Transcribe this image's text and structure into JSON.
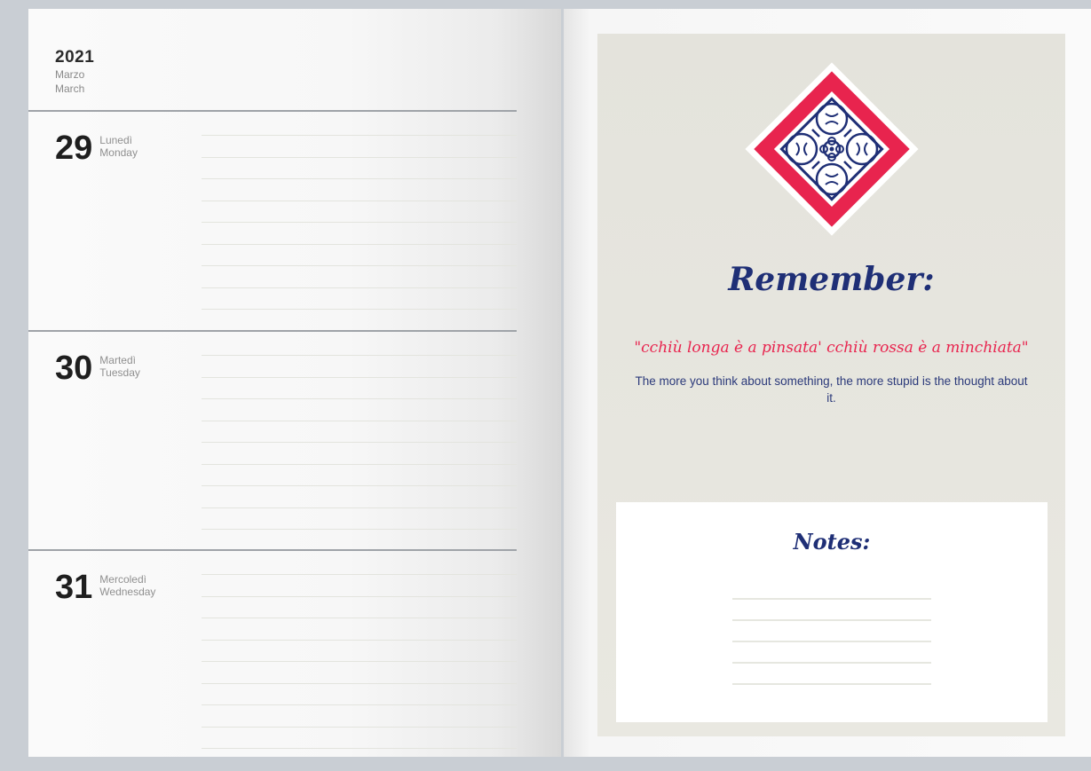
{
  "planner": {
    "year": "2021",
    "month_it": "Marzo",
    "month_en": "March",
    "days": [
      {
        "num": "29",
        "name_it": "Lunedì",
        "name_en": "Monday"
      },
      {
        "num": "30",
        "name_it": "Martedì",
        "name_en": "Tuesday"
      },
      {
        "num": "31",
        "name_it": "Mercoledì",
        "name_en": "Wednesday"
      }
    ]
  },
  "right_page": {
    "heading": "Remember:",
    "quote": "\"cchiù longa è a pinsata' cchiù rossa è a minchiata\"",
    "translation": "The more you think about something, the more stupid is the thought about it.",
    "notes_title": "Notes:"
  },
  "colors": {
    "navy": "#1f2f76",
    "red": "#e8244e",
    "panel": "#e6e5de"
  },
  "icons": {
    "tile": "majolica-tile-icon"
  }
}
